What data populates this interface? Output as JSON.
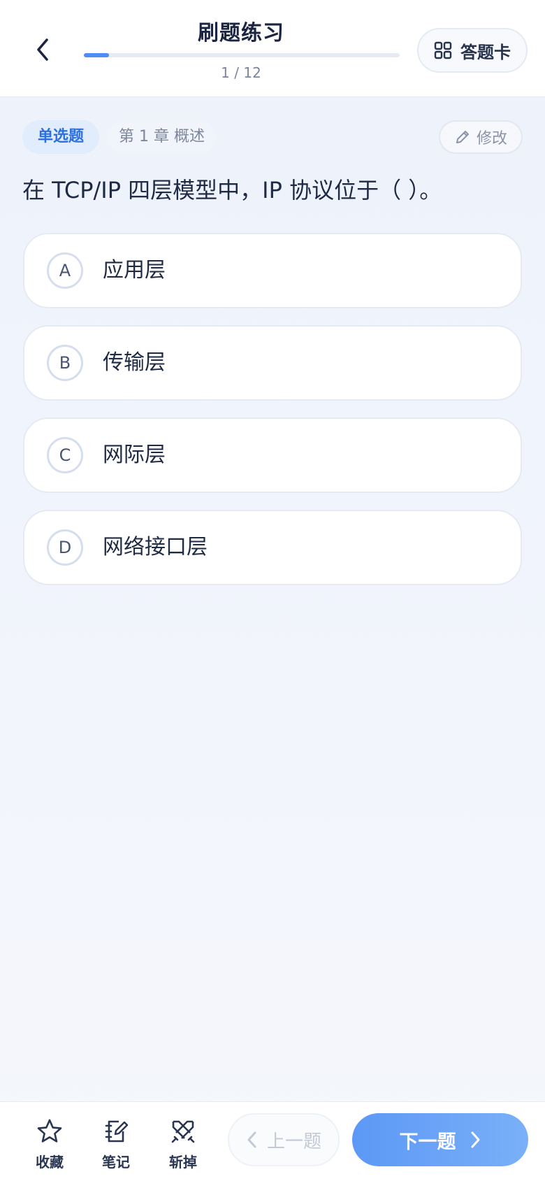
{
  "header": {
    "title": "刷题练习",
    "progress_text": "1 / 12",
    "progress_fraction": 0.08,
    "card_button_label": "答题卡"
  },
  "question": {
    "type_tag": "单选题",
    "chapter_tag": "第 1 章 概述",
    "edit_label": "修改",
    "stem": "在 TCP/IP 四层模型中，IP 协议位于（ ）。",
    "options": [
      {
        "letter": "A",
        "text": "应用层"
      },
      {
        "letter": "B",
        "text": "传输层"
      },
      {
        "letter": "C",
        "text": "网际层"
      },
      {
        "letter": "D",
        "text": "网络接口层"
      }
    ]
  },
  "bottom": {
    "favorite_label": "收藏",
    "note_label": "笔记",
    "remove_label": "斩掉",
    "prev_label": "上一题",
    "next_label": "下一题"
  },
  "icons": {
    "back": "chevron-left-icon",
    "card": "grid-icon",
    "edit": "pencil-icon",
    "favorite": "star-icon",
    "note": "notebook-pen-icon",
    "remove": "crossed-swords-icon",
    "prev": "chevron-left-icon",
    "next": "chevron-right-icon"
  },
  "colors": {
    "accent": "#4f8df5",
    "tag_bg": "#e1ecfd",
    "tag_text": "#2c6fe0"
  }
}
